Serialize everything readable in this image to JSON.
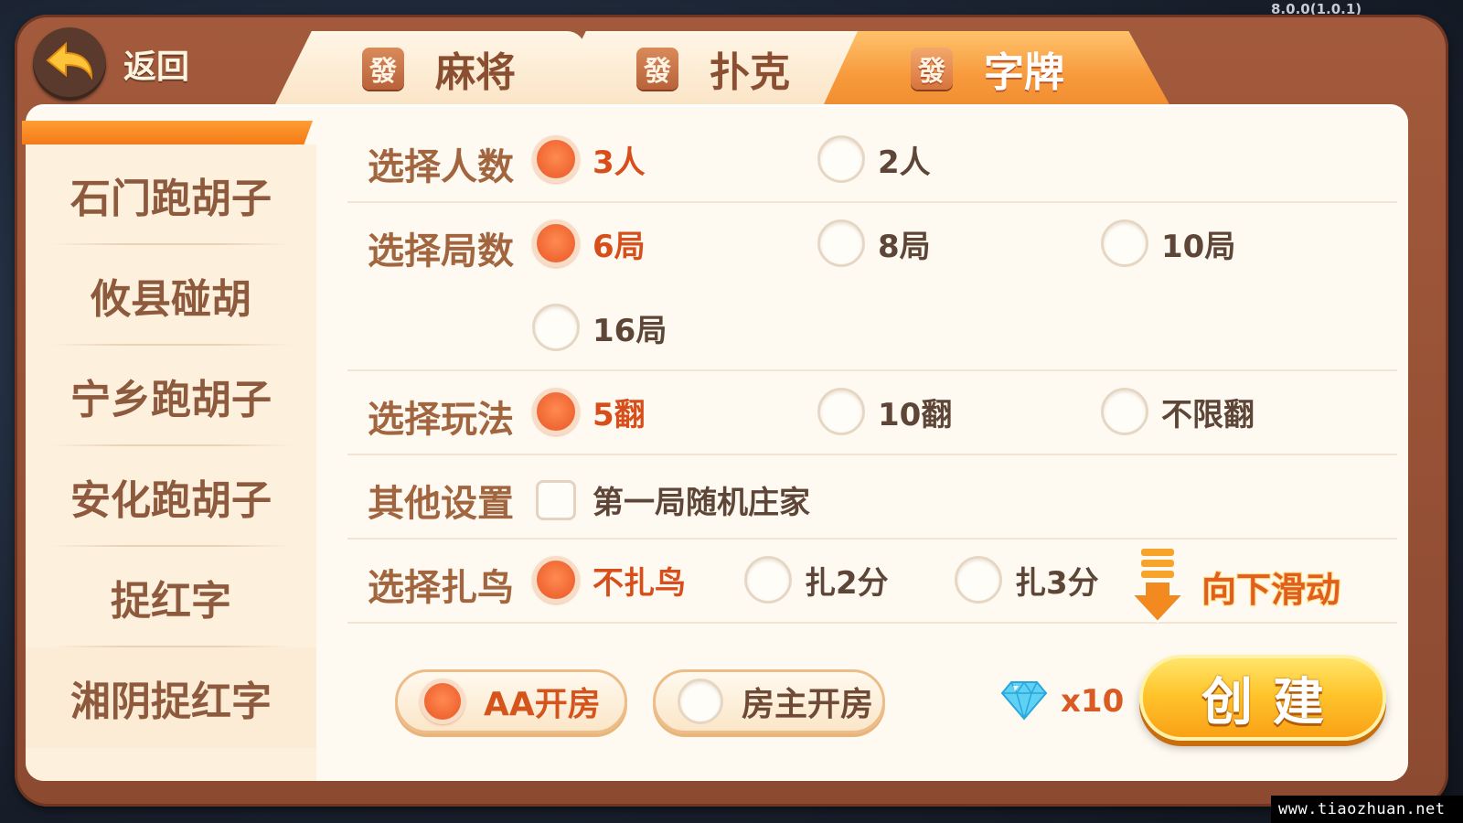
{
  "version": "8.0.0(1.0.1)",
  "watermark": "www.tiaozhuan.net",
  "back_label": "返回",
  "tabs": [
    {
      "icon": "發",
      "label": "麻将"
    },
    {
      "icon": "發",
      "label": "扑克"
    },
    {
      "icon": "發",
      "label": "字牌"
    }
  ],
  "sidebar": [
    {
      "label": "石门跑胡子"
    },
    {
      "label": "攸县碰胡"
    },
    {
      "label": "宁乡跑胡子"
    },
    {
      "label": "安化跑胡子"
    },
    {
      "label": "捉红字"
    },
    {
      "label": "湘阴捉红字"
    }
  ],
  "rows": {
    "players": {
      "label": "选择人数",
      "options": [
        "3人",
        "2人"
      ],
      "selected": "3人"
    },
    "rounds": {
      "label": "选择局数",
      "options": [
        "6局",
        "8局",
        "10局",
        "16局"
      ],
      "selected": "6局"
    },
    "mode": {
      "label": "选择玩法",
      "options": [
        "5翻",
        "10翻",
        "不限翻"
      ],
      "selected": "5翻"
    },
    "other": {
      "label": "其他设置",
      "checkbox": "第一局随机庄家",
      "checked": false
    },
    "bird": {
      "label": "选择扎鸟",
      "options": [
        "不扎鸟",
        "扎2分",
        "扎3分"
      ],
      "selected": "不扎鸟"
    }
  },
  "scroll_hint": "向下滑动",
  "room_type": {
    "options": [
      "AA开房",
      "房主开房"
    ],
    "selected": "AA开房"
  },
  "cost": "x10",
  "create_label": "创建",
  "colors": {
    "accent": "#f26b36",
    "tab_active": "#f79a3c",
    "frame": "#9a5236",
    "create": "#ffc52d"
  }
}
